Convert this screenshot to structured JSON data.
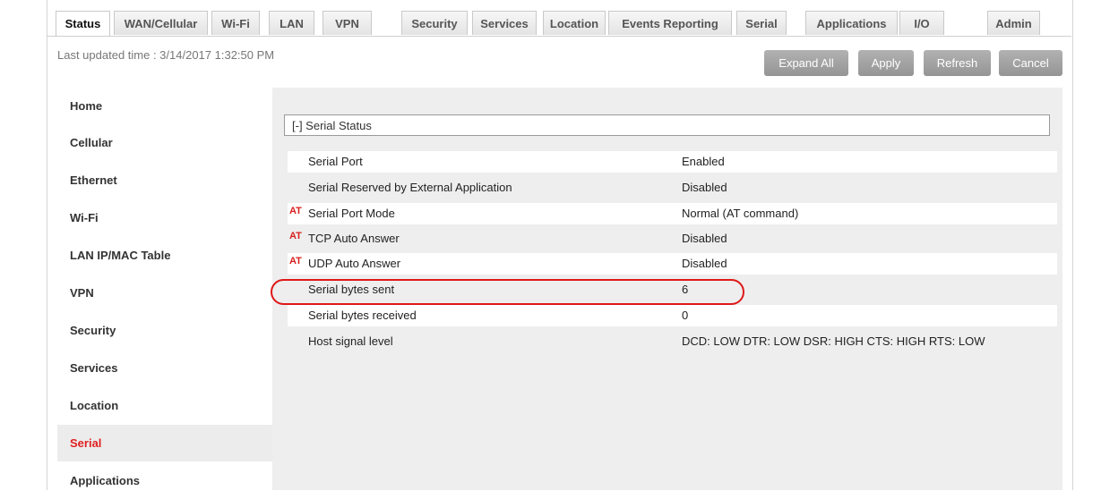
{
  "tabs": [
    "Status",
    "WAN/Cellular",
    "Wi-Fi",
    "LAN",
    "VPN",
    "Security",
    "Services",
    "Location",
    "Events Reporting",
    "Serial",
    "Applications",
    "I/O",
    "Admin"
  ],
  "last_updated": "Last updated time : 3/14/2017 1:32:50 PM",
  "buttons": {
    "expand_all": "Expand All",
    "apply": "Apply",
    "refresh": "Refresh",
    "cancel": "Cancel"
  },
  "sidebar": [
    "Home",
    "Cellular",
    "Ethernet",
    "Wi-Fi",
    "LAN IP/MAC Table",
    "VPN",
    "Security",
    "Services",
    "Location",
    "Serial",
    "Applications"
  ],
  "active_sidebar": "Serial",
  "active_tab": "Status",
  "section_title": "[-] Serial Status",
  "at_marker": "AT",
  "rows": [
    {
      "label": "Serial Port",
      "value": "Enabled",
      "at": false
    },
    {
      "label": "Serial Reserved by External Application",
      "value": "Disabled",
      "at": false
    },
    {
      "label": "Serial Port Mode",
      "value": "Normal (AT command)",
      "at": true
    },
    {
      "label": "TCP Auto Answer",
      "value": "Disabled",
      "at": true
    },
    {
      "label": "UDP Auto Answer",
      "value": "Disabled",
      "at": true
    },
    {
      "label": "Serial bytes sent",
      "value": "6",
      "at": false
    },
    {
      "label": "Serial bytes received",
      "value": "0",
      "at": false
    },
    {
      "label": "Host signal level",
      "value": "DCD: LOW DTR: LOW DSR: HIGH CTS: HIGH RTS: LOW",
      "at": false
    }
  ],
  "colors": {
    "active_text": "#e02020",
    "highlight": "#e01818",
    "button": "#a6a6a6"
  }
}
